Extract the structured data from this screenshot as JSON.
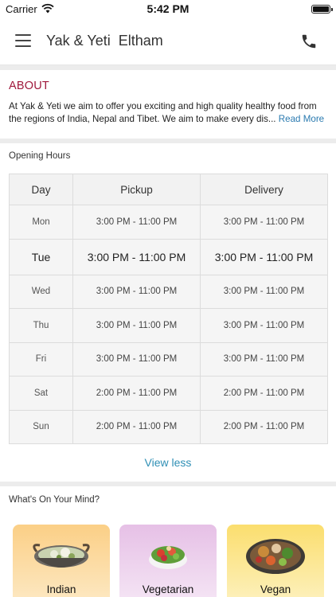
{
  "status_bar": {
    "carrier": "Carrier",
    "time": "5:42 PM"
  },
  "header": {
    "title": "Yak & Yeti  Eltham",
    "menu_icon": "hamburger-menu-icon",
    "phone_icon": "phone-icon"
  },
  "about": {
    "heading": "ABOUT",
    "line1": "At Yak & Yeti we aim to offer you exciting and high quality healthy food from",
    "line2": "the regions of India, Nepal and Tibet. We aim to make every dis...",
    "read_more": "Read More"
  },
  "hours": {
    "heading": "Opening Hours",
    "columns": {
      "day": "Day",
      "pickup": "Pickup",
      "delivery": "Delivery"
    },
    "rows": [
      {
        "day": "Mon",
        "pickup": "3:00 PM - 11:00 PM",
        "delivery": "3:00 PM - 11:00 PM"
      },
      {
        "day": "Tue",
        "pickup": "3:00 PM - 11:00 PM",
        "delivery": "3:00 PM - 11:00 PM"
      },
      {
        "day": "Wed",
        "pickup": "3:00 PM - 11:00 PM",
        "delivery": "3:00 PM - 11:00 PM"
      },
      {
        "day": "Thu",
        "pickup": "3:00 PM - 11:00 PM",
        "delivery": "3:00 PM - 11:00 PM"
      },
      {
        "day": "Fri",
        "pickup": "3:00 PM - 11:00 PM",
        "delivery": "3:00 PM - 11:00 PM"
      },
      {
        "day": "Sat",
        "pickup": "2:00 PM - 11:00 PM",
        "delivery": "2:00 PM - 11:00 PM"
      },
      {
        "day": "Sun",
        "pickup": "2:00 PM - 11:00 PM",
        "delivery": "2:00 PM - 11:00 PM"
      }
    ],
    "view_less": "View less"
  },
  "mind": {
    "heading": "What's On Your Mind?",
    "cards": [
      {
        "label": "Indian"
      },
      {
        "label": "Vegetarian"
      },
      {
        "label": "Vegan"
      }
    ]
  },
  "colors": {
    "accent_red": "#a0193c",
    "link_blue": "#2a7ab0",
    "view_less_blue": "#2f8fb5"
  }
}
